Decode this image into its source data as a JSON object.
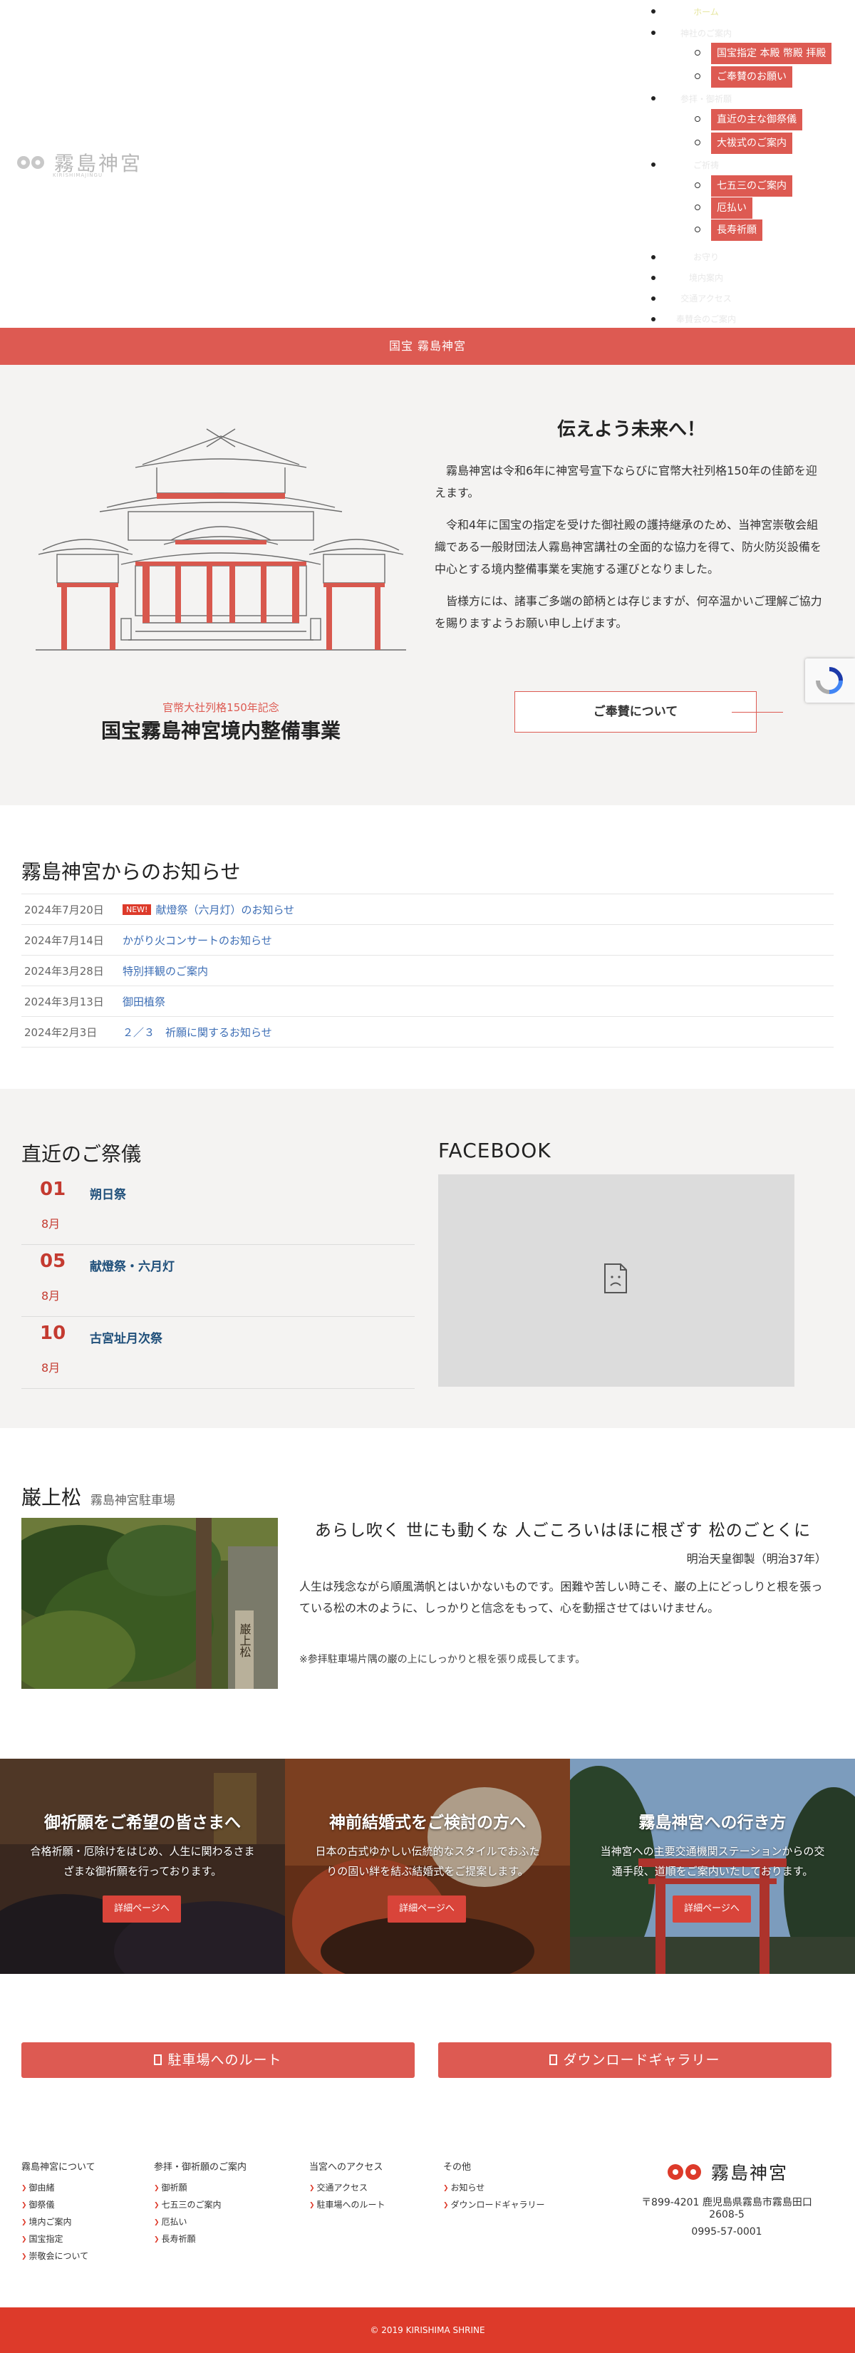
{
  "logo": {
    "name": "霧島神宮",
    "sub": "KIRISHIMAJINGU"
  },
  "nav": {
    "items": [
      "ホーム",
      "神社のご案内",
      "参拝・御祈願",
      "ご祈祷",
      "お守り",
      "境内案内",
      "交通アクセス",
      "奉賛会のご案内"
    ],
    "sub_about": [
      "国宝指定 本殿 幣殿 拝殿",
      "ご奉賛のお願い"
    ],
    "sub_worship": [
      "直近の主な御祭儀",
      "大祓式のご案内"
    ],
    "sub_prayer": [
      "七五三のご案内",
      "厄払い",
      "長寿祈願"
    ]
  },
  "band_text": "国宝 霧島神宮",
  "hero": {
    "title": "伝えよう未来へ！",
    "paragraphs": [
      "霧島神宮は令和6年に神宮号宣下ならびに官幣大社列格150年の佳節を迎えます。",
      "令和4年に国宝の指定を受けた御社殿の護持継承のため、当神宮崇敬会組織である一般財団法人霧島神宮講社の全面的な協力を得て、防火防災設備を中心とする境内整備事業を実施する運びとなりました。",
      "皆様方には、諸事ご多端の節柄とは存じますが、何卒温かいご理解ご協力を賜りますようお願い申し上げます。"
    ],
    "sub_heading": "官幣大社列格150年記念",
    "heading": "国宝霧島神宮境内整備事業",
    "button": "ご奉賛について"
  },
  "news": {
    "title": "霧島神宮からのお知らせ",
    "new_badge": "NEW!",
    "items": [
      {
        "date": "2024年7月20日",
        "text": "献燈祭（六月灯）のお知らせ"
      },
      {
        "date": "2024年7月14日",
        "text": "かがり火コンサートのお知らせ"
      },
      {
        "date": "2024年3月28日",
        "text": "特別拝観のご案内"
      },
      {
        "date": "2024年3月13日",
        "text": "御田植祭"
      },
      {
        "date": "2024年2月3日",
        "text": "２／３　祈願に関するお知らせ"
      }
    ]
  },
  "events": {
    "title": "直近のご祭儀",
    "items": [
      {
        "day": "01",
        "month": "8月",
        "name": "朔日祭"
      },
      {
        "day": "05",
        "month": "8月",
        "name": "献燈祭・六月灯"
      },
      {
        "day": "10",
        "month": "8月",
        "name": "古宮址月次祭"
      }
    ]
  },
  "facebook": {
    "title": "FACEBOOK"
  },
  "pine": {
    "title": "巌上松",
    "subtitle": "霧島神宮駐車場",
    "photo_sign": "巌上松",
    "poem": "あらし吹く 世にも動くな 人ごころいはほに根ざす 松のごとくに",
    "author": "明治天皇御製（明治37年）",
    "body": "人生は残念ながら順風満帆とはいかないものです。困難や苦しい時こそ、巌の上にどっしりと根を張っている松の木のように、しっかりと信念をもって、心を動揺させてはいけません。",
    "note": "※参拝駐車場片隅の巌の上にしっかりと根を張り成長してます。"
  },
  "banners": [
    {
      "title": "御祈願をご希望の皆さまへ",
      "text": "合格祈願・厄除けをはじめ、人生に関わるさまざまな御祈願を行っております。",
      "button": "詳細ページへ"
    },
    {
      "title": "神前結婚式をご検討の方へ",
      "text": "日本の古式ゆかしい伝統的なスタイルでおふたりの固い絆を結ぶ結婚式をご提案します。",
      "button": "詳細ページへ"
    },
    {
      "title": "霧島神宮への行き方",
      "text": "当神宮への主要交通機関ステーションからの交通手段、道順をご案内いたしております。",
      "button": "詳細ページへ"
    }
  ],
  "big_buttons": [
    "駐車場へのルート",
    "ダウンロードギャラリー"
  ],
  "footer": {
    "cols": [
      {
        "title": "霧島神宮について",
        "links": [
          "御由緒",
          "御祭儀",
          "境内ご案内",
          "国宝指定",
          "崇敬会について"
        ]
      },
      {
        "title": "参拝・御祈願のご案内",
        "links": [
          "御祈願",
          "七五三のご案内",
          "厄払い",
          "長寿祈願"
        ]
      },
      {
        "title": "当宮へのアクセス",
        "links": [
          "交通アクセス",
          "駐車場へのルート"
        ]
      },
      {
        "title": "その他",
        "links": [
          "お知らせ",
          "ダウンロードギャラリー"
        ]
      }
    ],
    "brand": "霧島神宮",
    "address": "〒899-4201 鹿児島県霧島市霧島田口2608-5",
    "tel": "0995-57-0001",
    "copyright": "© 2019 KIRISHIMA SHRINE"
  },
  "colors": {
    "accent": "#dd5a52",
    "accent_dark": "#dd3a2a",
    "date_red": "#c43a30",
    "link_blue": "#3d6eb5"
  }
}
